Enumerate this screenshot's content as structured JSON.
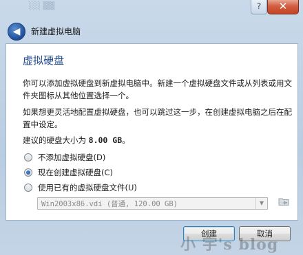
{
  "window": {
    "title": "新建虚拟电脑",
    "help_label": "?",
    "close_label": "✕",
    "back_symbol": "◀"
  },
  "page": {
    "heading": "虚拟硬盘",
    "para1": "你可以添加虚拟硬盘到新虚拟电脑中。新建一个虚拟硬盘文件或从列表或用文件夹图标从其他位置选择一个。",
    "para2": "如果想更灵活地配置虚拟硬盘，也可以跳过这一步，在创建虚拟电脑之后在配置中设定。",
    "recommend_prefix": "建议的硬盘大小为 ",
    "recommend_size": "8.00 GB",
    "recommend_suffix": "。"
  },
  "options": [
    {
      "label": "不添加虚拟硬盘(D)",
      "checked": false
    },
    {
      "label": "现在创建虚拟硬盘(C)",
      "checked": true
    },
    {
      "label": "使用已有的虚拟硬盘文件(U)",
      "checked": false
    }
  ],
  "file_select": {
    "value": "Win2003x86.vdi (普通, 120.00 GB)",
    "arrow": "▼"
  },
  "buttons": {
    "create": "创建",
    "cancel": "取消"
  },
  "watermark": "小 宇's blog",
  "colors": {
    "heading": "#1f4a8c",
    "accent": "#3c7fb1"
  }
}
